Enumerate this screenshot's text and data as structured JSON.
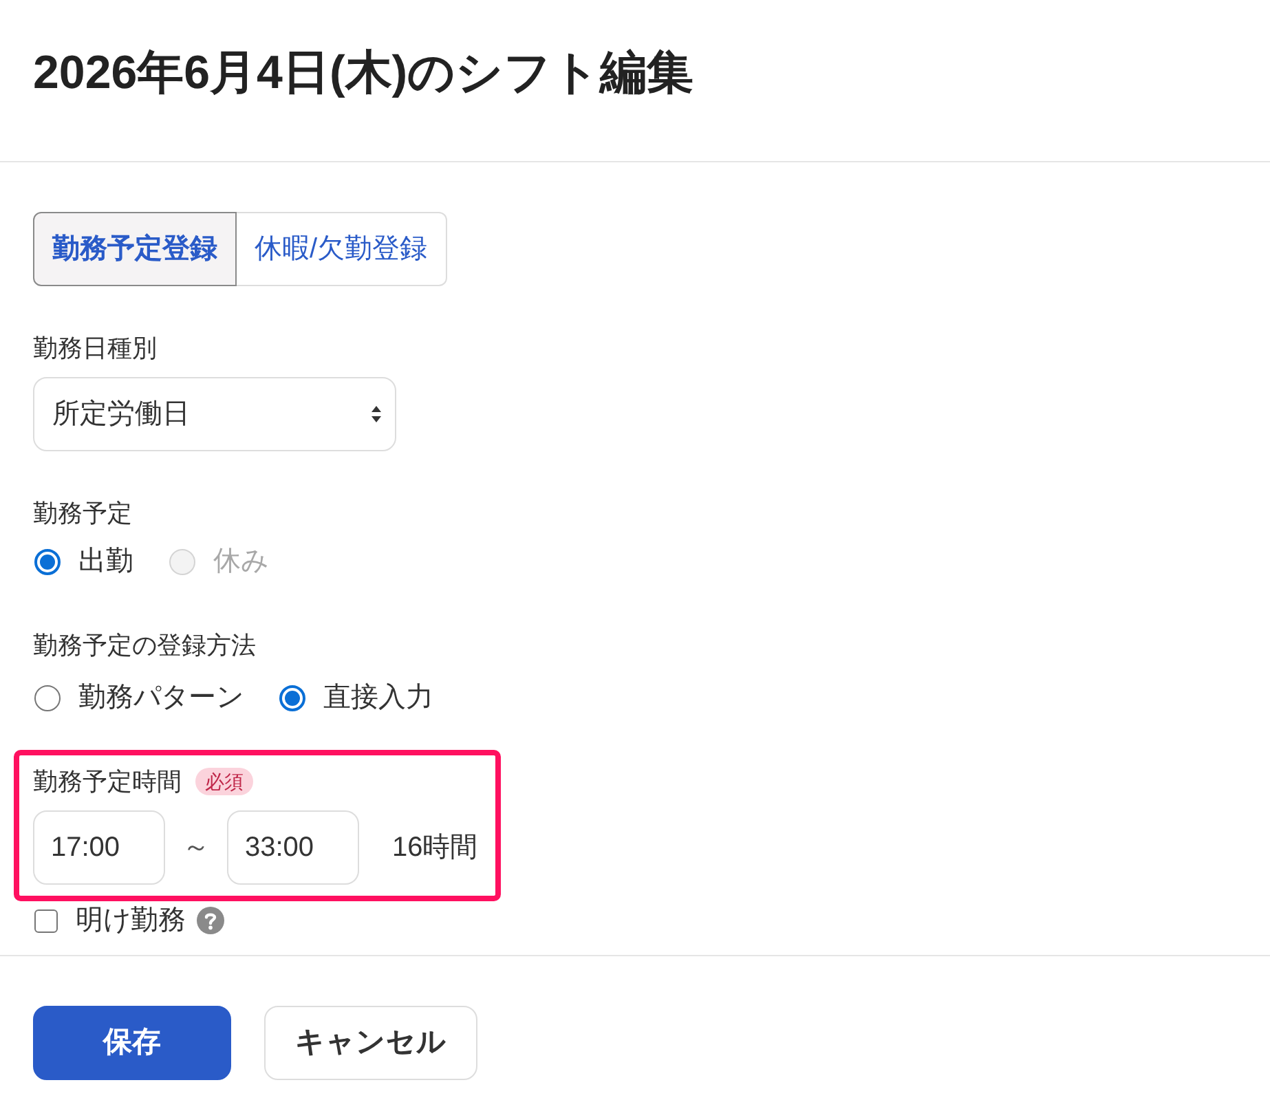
{
  "title": "2026年6月4日(木)のシフト編集",
  "tabs": [
    {
      "label": "勤務予定登録",
      "selected": true
    },
    {
      "label": "休暇/欠勤登録",
      "selected": false
    }
  ],
  "day_type": {
    "label": "勤務日種別",
    "value": "所定労働日"
  },
  "schedule": {
    "label": "勤務予定",
    "options": [
      {
        "label": "出勤",
        "selected": true,
        "disabled": false
      },
      {
        "label": "休み",
        "selected": false,
        "disabled": true
      }
    ]
  },
  "method": {
    "label": "勤務予定の登録方法",
    "options": [
      {
        "label": "勤務パターン",
        "selected": false
      },
      {
        "label": "直接入力",
        "selected": true
      }
    ]
  },
  "time": {
    "label": "勤務予定時間",
    "badge": "必須",
    "highlighted": true,
    "start": "17:00",
    "separator": "～",
    "end": "33:00",
    "duration": "16時間"
  },
  "next_day_work": {
    "label": "明け勤務",
    "checked": false
  },
  "buttons": [
    {
      "label": "保存",
      "kind": "primary"
    },
    {
      "label": "キャンセル",
      "kind": "secondary"
    }
  ]
}
